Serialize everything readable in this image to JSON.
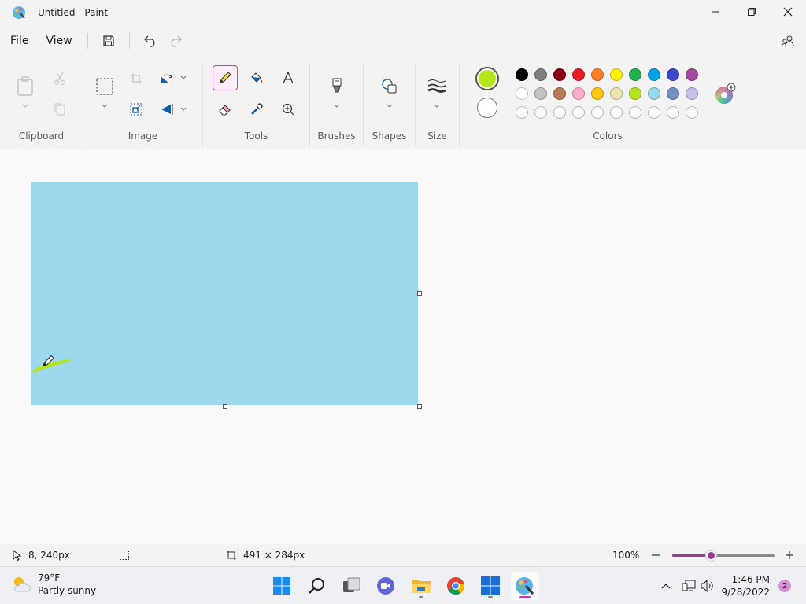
{
  "window": {
    "title": "Untitled - Paint"
  },
  "menu": {
    "file": "File",
    "view": "View"
  },
  "ribbon": {
    "groups": {
      "clipboard": "Clipboard",
      "image": "Image",
      "tools": "Tools",
      "brushes": "Brushes",
      "shapes": "Shapes",
      "size": "Size",
      "colors": "Colors"
    }
  },
  "colors": {
    "primary": "#b5e61d",
    "secondary": "#ffffff",
    "row1": [
      "#000000",
      "#7f7f7f",
      "#880015",
      "#ed1c24",
      "#ff7f27",
      "#fff200",
      "#22b14c",
      "#00a2e8",
      "#3f48cc",
      "#a349a4"
    ],
    "row2": [
      "#ffffff",
      "#c3c3c3",
      "#b97a57",
      "#ffaec9",
      "#ffc90e",
      "#efe4b0",
      "#b5e61d",
      "#99d9ea",
      "#7092be",
      "#c8bfe7"
    ],
    "row3_empty_count": 10
  },
  "canvas": {
    "fill": "#9cd9ec"
  },
  "status": {
    "cursor_pos": "8, 240px",
    "canvas_size": "491 × 284px",
    "zoom": "100%",
    "zoom_level": 0.38
  },
  "taskbar": {
    "temperature": "79°F",
    "weather": "Partly sunny",
    "time": "1:46 PM",
    "date": "9/28/2022",
    "notifications": "2"
  }
}
